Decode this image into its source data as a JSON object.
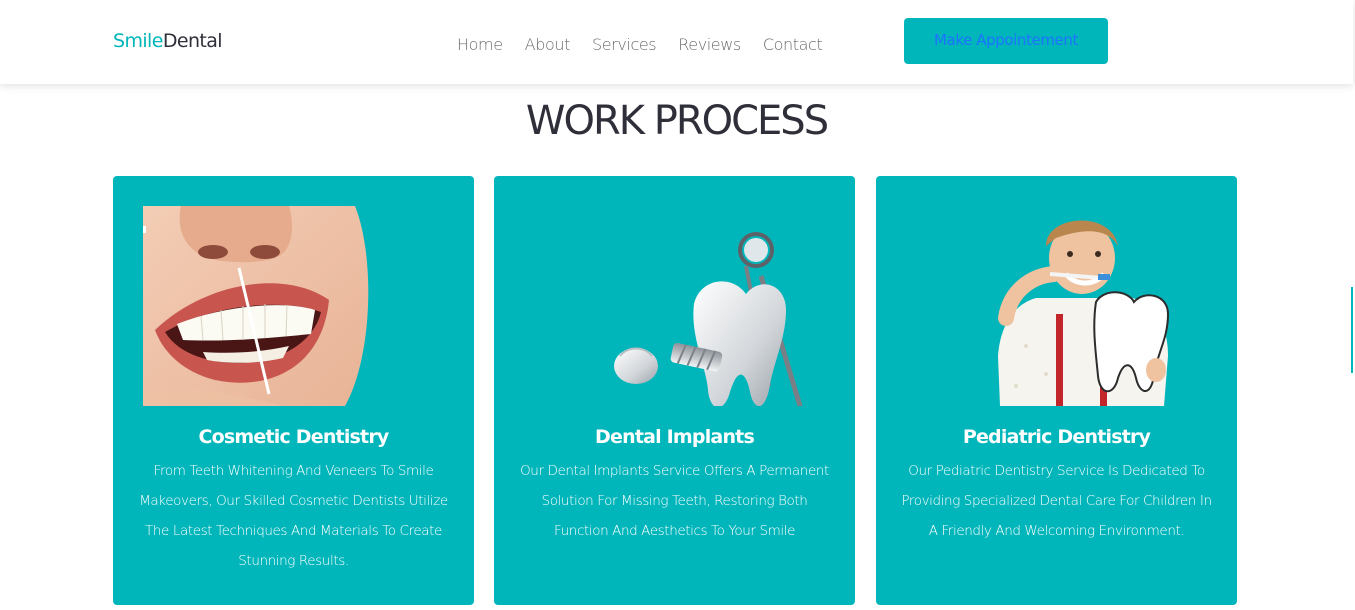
{
  "brand": {
    "part1": "Smile",
    "part2": "Dental",
    "accent": "#00b6ba"
  },
  "nav": {
    "links": [
      "Home",
      "About",
      "Services",
      "Reviews",
      "Contact"
    ],
    "cta": "Make Appointement"
  },
  "section": {
    "title": "WORK PROCESS"
  },
  "cards": [
    {
      "title": "Cosmetic Dentistry",
      "desc": "From Teeth Whitening And Veneers To Smile Makeovers, Our Skilled Cosmetic Dentists Utilize The Latest Techniques And Materials To Create Stunning Results.",
      "image": "smile-teeth-whitening-image"
    },
    {
      "title": "Dental Implants",
      "desc": "Our Dental Implants Service Offers A Permanent Solution For Missing Teeth, Restoring Both Function And Aesthetics To Your Smile",
      "image": "tooth-implant-tools-image"
    },
    {
      "title": "Pediatric Dentistry",
      "desc": "Our Pediatric Dentistry Service Is Dedicated To Providing Specialized Dental Care For Children In A Friendly And Welcoming Environment.",
      "image": "child-brushing-teeth-image"
    }
  ]
}
